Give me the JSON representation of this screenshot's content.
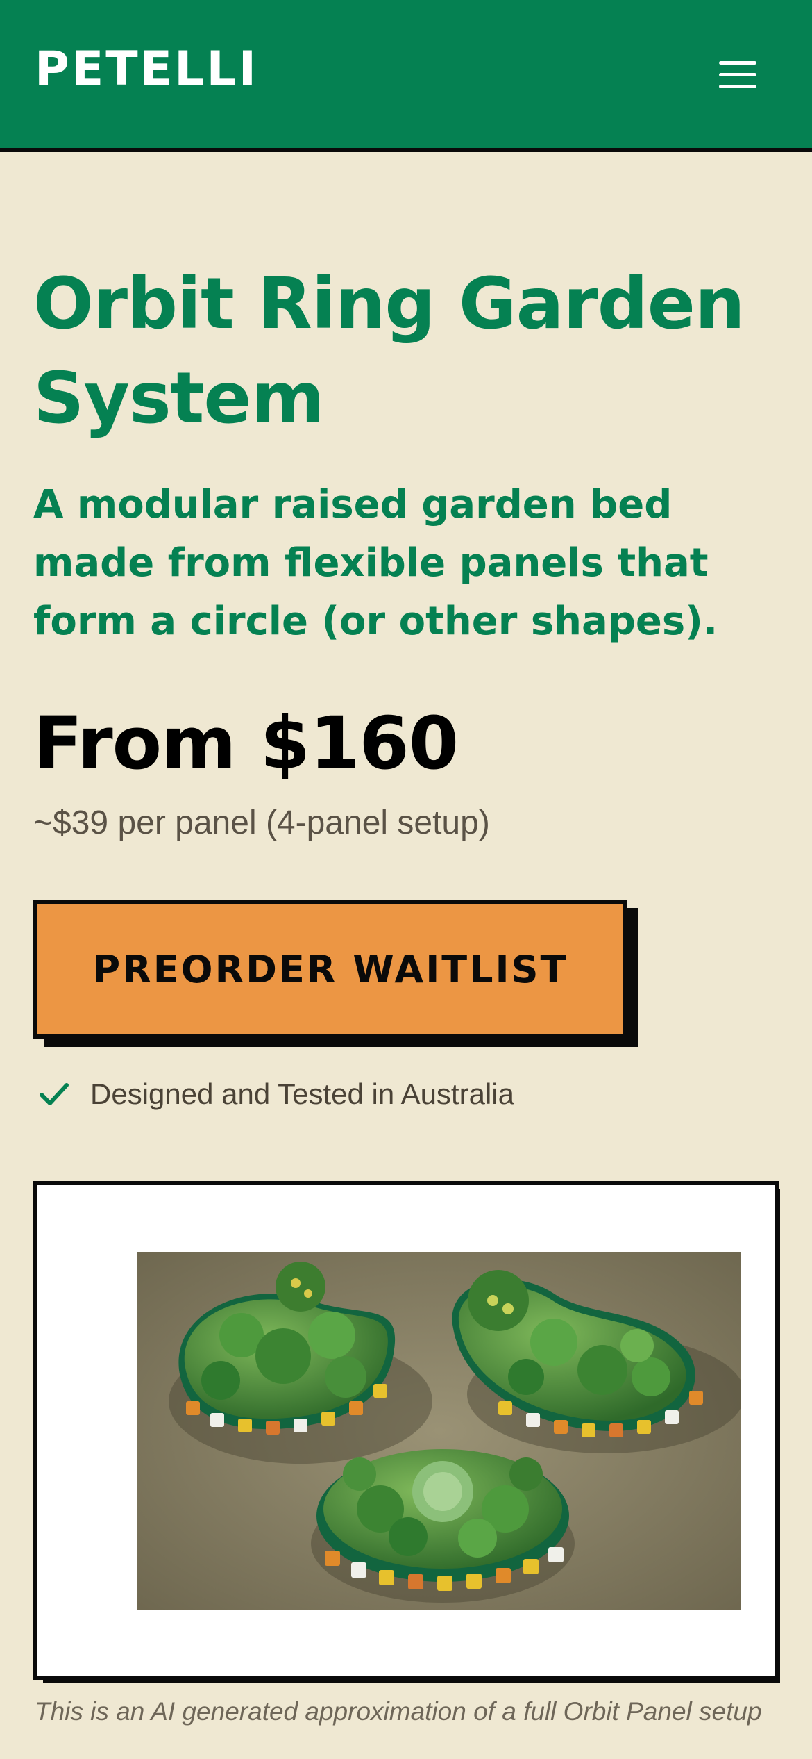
{
  "header": {
    "logo": "PETELLI",
    "menu_icon": "hamburger-menu-icon",
    "background": "#058152"
  },
  "hero": {
    "title": "Orbit Ring Garden System",
    "subtitle": "A modular raised garden bed made from flexible panels that form a circle (or other shapes).",
    "price": "From $160",
    "price_note": "~$39 per panel (4-panel setup)",
    "cta_label": "PREORDER WAITLIST",
    "feature_icon": "check-icon",
    "feature_text": "Designed and Tested in Australia"
  },
  "media": {
    "caption": "This is an AI generated approximation of a full Orbit Panel setup"
  },
  "colors": {
    "brand_green": "#058152",
    "accent_orange": "#ec9644",
    "background": "#efe8d2"
  }
}
